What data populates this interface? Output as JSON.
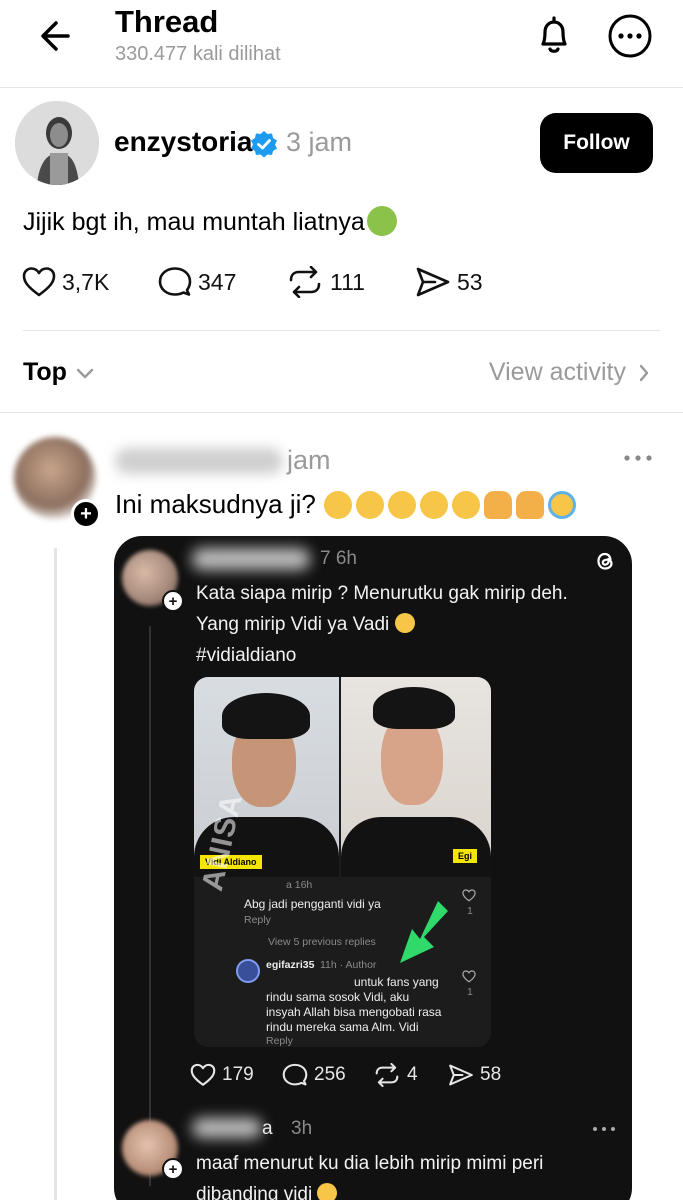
{
  "header": {
    "title": "Thread",
    "views": "330.477 kali dilihat"
  },
  "post": {
    "username": "enzystoria",
    "time": "3 jam",
    "follow_label": "Follow",
    "text": "Jijik bgt ih, mau muntah liatnya",
    "likes": "3,7K",
    "replies": "347",
    "reposts": "111",
    "shares": "53"
  },
  "sort": {
    "label": "Top",
    "view_activity": "View activity"
  },
  "reply": {
    "time": "jam",
    "text": "Ini maksudnya ji?"
  },
  "embed": {
    "time": "7 6h",
    "text_lines": [
      "Kata siapa mirip ? Menurutku gak mirip deh.",
      "Yang mirip Vidi ya Vadi",
      "#vidialdiano"
    ],
    "screenshot": {
      "tag_left": "Vidi Aldiano",
      "tag_right": "Egi",
      "comment1_meta": "a 16h",
      "comment1_text": "Abg jadi pengganti vidi ya",
      "reply_label": "Reply",
      "like1": "1",
      "view_prev": "View 5 previous replies",
      "comment2_user": "egifazri35",
      "comment2_meta": "11h · Author",
      "comment2_lines": [
        "untuk fans yang",
        "rindu sama sosok Vidi, aku",
        "insyah Allah bisa mengobati rasa",
        "rindu mereka sama Alm. Vidi"
      ],
      "like2": "1",
      "watermark": "ANISA"
    },
    "likes": "179",
    "replies": "256",
    "reposts": "4",
    "shares": "58",
    "reply2": {
      "name": "a",
      "time": "3h",
      "text_lines": [
        "maaf menurut ku dia lebih mirip mimi peri",
        "dibanding vidi"
      ]
    }
  },
  "icons": {
    "back": "arrow-left-icon",
    "bell": "bell-icon",
    "more": "more-icon",
    "verified": "verified-badge-icon",
    "heart": "heart-icon",
    "comment": "comment-icon",
    "repost": "repost-icon",
    "share": "send-icon",
    "threads": "threads-logo-icon"
  },
  "colors": {
    "accent_verified": "#1d9bf0",
    "muted_text": "#9a9a9a",
    "follow_bg": "#000000",
    "card_bg": "#111111",
    "arrow_green": "#2fd96a"
  }
}
